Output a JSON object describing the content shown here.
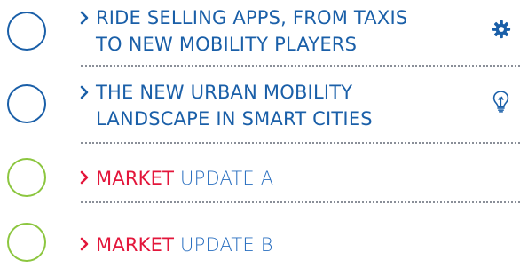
{
  "colors": {
    "blue": "#1a5fa8",
    "green": "#8cc63f",
    "red": "#e3163b",
    "divider": "#8a8f98"
  },
  "items": [
    {
      "line1": "RIDE SELLING APPS, FROM TAXIS",
      "line2": "TO NEW MOBILITY PLAYERS",
      "icon": "gear-icon"
    },
    {
      "line1": "THE NEW URBAN MOBILITY",
      "line2": "LANDSCAPE IN SMART CITIES",
      "icon": "lightbulb-icon"
    },
    {
      "strong": "MARKET",
      "rest": " UPDATE A"
    },
    {
      "strong": "MARKET",
      "rest": " UPDATE B"
    }
  ]
}
